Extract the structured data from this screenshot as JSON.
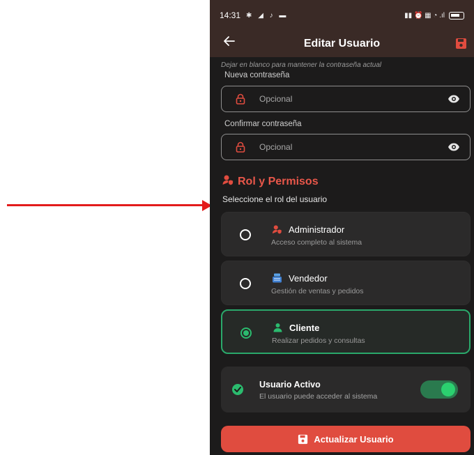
{
  "status_bar": {
    "time": "14:31",
    "left_icons": "✱ ◢ ♪ ▬",
    "right_icons": "▮▮ ⏰ ▦ ◔ .ıl",
    "battery": "80"
  },
  "app_bar": {
    "title": "Editar Usuario",
    "back_icon": "arrow-left-icon",
    "save_icon": "save-icon"
  },
  "password": {
    "hint": "Dejar en blanco para mantener la contraseña actual",
    "new_label": "Nueva contraseña",
    "new_placeholder": "Opcional",
    "confirm_label": "Confirmar contraseña",
    "confirm_placeholder": "Opcional"
  },
  "roles": {
    "section_title": "Rol y Permisos",
    "subtitle": "Seleccione el rol del usuario",
    "items": [
      {
        "name": "Administrador",
        "description": "Acceso completo al sistema",
        "icon": "admin-shield-icon",
        "selected": false
      },
      {
        "name": "Vendedor",
        "description": "Gestión de ventas y pedidos",
        "icon": "vendor-badge-icon",
        "selected": false
      },
      {
        "name": "Cliente",
        "description": "Realizar pedidos y consultas",
        "icon": "person-icon",
        "selected": true
      }
    ]
  },
  "active": {
    "title": "Usuario Activo",
    "description": "El usuario puede acceder al sistema",
    "enabled": true
  },
  "update_button": {
    "label": "Actualizar Usuario"
  },
  "colors": {
    "accent": "#e04c3f",
    "success": "#2bbb6e",
    "app_bar": "#3a2a26",
    "background": "#1c1b1b"
  }
}
